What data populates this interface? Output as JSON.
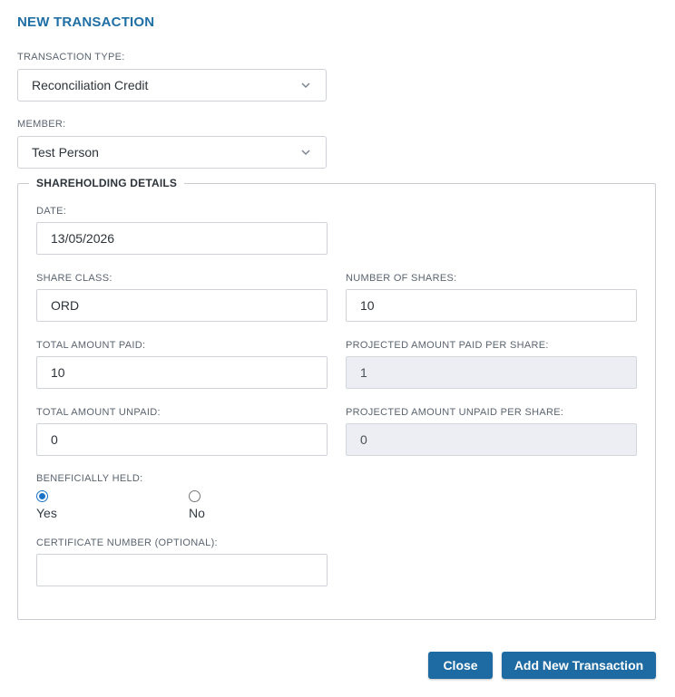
{
  "dialog": {
    "title": "NEW TRANSACTION"
  },
  "transaction_type": {
    "label": "TRANSACTION TYPE:",
    "value": "Reconciliation Credit"
  },
  "member": {
    "label": "MEMBER:",
    "value": "Test Person"
  },
  "shareholding": {
    "legend": "SHAREHOLDING DETAILS",
    "date": {
      "label": "DATE:",
      "value": "13/05/2026"
    },
    "share_class": {
      "label": "SHARE CLASS:",
      "value": "ORD"
    },
    "number_of_shares": {
      "label": "NUMBER OF SHARES:",
      "value": "10"
    },
    "total_amount_paid": {
      "label": "TOTAL AMOUNT PAID:",
      "value": "10"
    },
    "projected_paid_per_share": {
      "label": "PROJECTED AMOUNT PAID PER SHARE:",
      "value": "1"
    },
    "total_amount_unpaid": {
      "label": "TOTAL AMOUNT UNPAID:",
      "value": "0"
    },
    "projected_unpaid_per_share": {
      "label": "PROJECTED AMOUNT UNPAID PER SHARE:",
      "value": "0"
    },
    "beneficially_held": {
      "label": "BENEFICIALLY HELD:",
      "options": [
        "Yes",
        "No"
      ],
      "selected": "Yes"
    },
    "certificate_number": {
      "label": "CERTIFICATE NUMBER (OPTIONAL):",
      "value": ""
    }
  },
  "buttons": {
    "close": "Close",
    "add": "Add New Transaction"
  },
  "colors": {
    "accent": "#1e6aa2",
    "title": "#1f6fa5",
    "radio": "#1a73c7",
    "readonly_bg": "#eceef3"
  },
  "icons": {
    "select_chevron": "chevron-down-icon"
  }
}
